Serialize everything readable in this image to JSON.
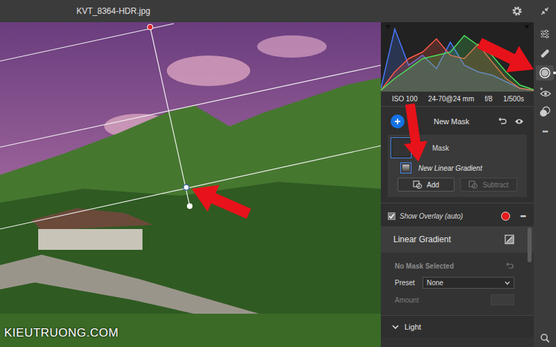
{
  "window": {
    "title": "KVT_8364-HDR.jpg"
  },
  "watermark": "KIEUTRUONG.COM",
  "histogram": {
    "series": [
      {
        "name": "blue",
        "color": "#4a7bff",
        "values": [
          0.05,
          0.95,
          0.4,
          0.55,
          0.35,
          0.75,
          0.4,
          0.3,
          0.25,
          0.15,
          0.05,
          0.02
        ]
      },
      {
        "name": "red",
        "color": "#ff5a4a",
        "values": [
          0.02,
          0.3,
          0.5,
          0.6,
          0.8,
          0.55,
          0.5,
          0.72,
          0.45,
          0.2,
          0.05,
          0.02
        ]
      },
      {
        "name": "green",
        "color": "#4adf5a",
        "values": [
          0.02,
          0.2,
          0.35,
          0.5,
          0.55,
          0.6,
          0.85,
          0.7,
          0.55,
          0.3,
          0.1,
          0.03
        ]
      }
    ]
  },
  "exif": [
    "ISO 100",
    "24-70@24 mm",
    "f/8",
    "1/500s"
  ],
  "masks": {
    "title": "New Mask",
    "items": [
      {
        "label": "Mask",
        "selected": true
      }
    ],
    "components": [
      {
        "label": "New Linear Gradient",
        "selected": false
      }
    ],
    "buttons": [
      {
        "label": "Add",
        "disabled": false
      },
      {
        "label": "Subtract",
        "disabled": true
      }
    ]
  },
  "overlay": {
    "label": "Show Overlay (auto)",
    "checked": true,
    "color": "#e81c1c",
    "more": "•••"
  },
  "tool_panel": {
    "title": "Linear Gradient",
    "status": "No Mask Selected",
    "preset": {
      "label": "Preset",
      "value": "None"
    },
    "amount": {
      "label": "Amount",
      "disabled": true
    }
  },
  "sections": [
    {
      "label": "Light",
      "expanded": true
    }
  ],
  "toolbar": [
    {
      "name": "edit",
      "selected": false
    },
    {
      "name": "heal",
      "selected": false
    },
    {
      "name": "masking",
      "selected": true
    },
    {
      "name": "red-eye",
      "selected": false
    },
    {
      "name": "presets",
      "selected": false
    },
    {
      "name": "more",
      "glyph": "•••",
      "selected": false
    },
    {
      "name": "zoom",
      "selected": false
    }
  ]
}
